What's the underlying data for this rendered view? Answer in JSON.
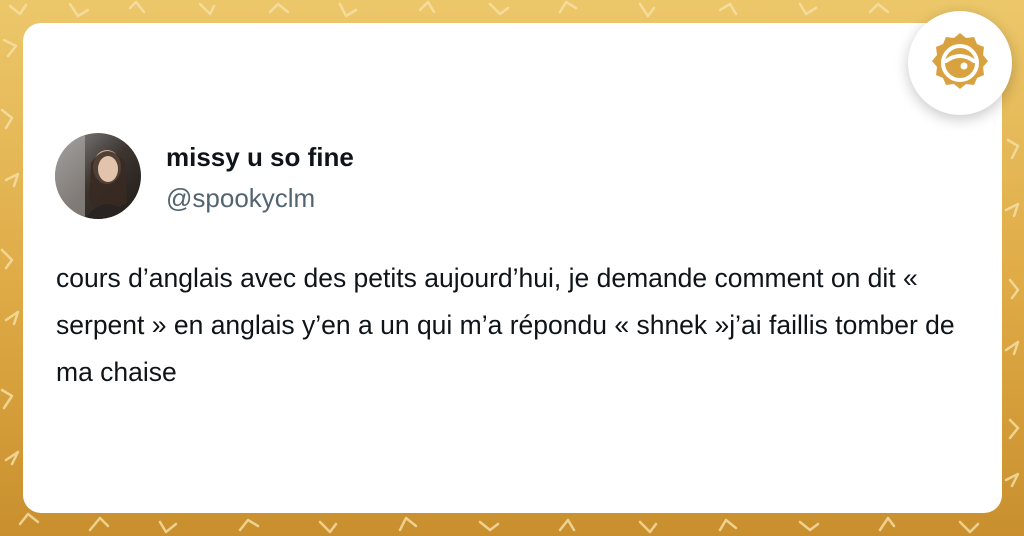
{
  "tweet": {
    "display_name": "missy u so fine",
    "handle": "@spookyclm",
    "text": "cours d’anglais avec des petits aujourd’hui, je demande comment on dit « serpent » en anglais y’en a un qui m’a répondu « shnek »j’ai faillis tomber de ma chaise"
  },
  "icons": {
    "avatar": "profile-photo",
    "logo": "site-logo-icon"
  },
  "colors": {
    "background": "#deaa45",
    "card": "#ffffff",
    "name_text": "#0f1419",
    "handle_text": "#536471",
    "logo_accent": "#d9a240"
  }
}
